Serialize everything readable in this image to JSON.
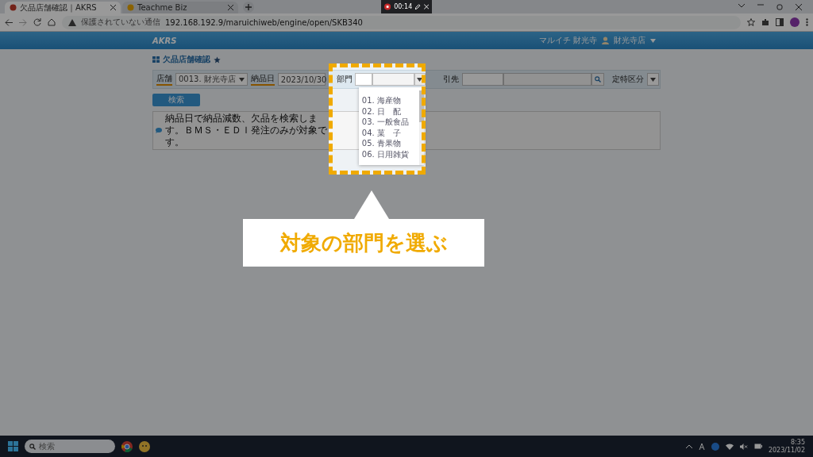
{
  "browser": {
    "tabs": [
      {
        "title": "欠品店舗確認｜AKRS",
        "selected": true
      },
      {
        "title": "Teachme Biz",
        "selected": false
      }
    ],
    "address": {
      "security": "保護されていない通信",
      "url": "192.168.192.9/maruichiweb/engine/open/SKB340"
    }
  },
  "recorder": {
    "time": "00:14"
  },
  "app_header": {
    "logo": "AKRS",
    "company": "マルイチ 財光寺",
    "user": "財光寺店"
  },
  "page": {
    "title": "欠品店舗確認",
    "form": {
      "store": {
        "label": "店舗",
        "value": "0013. 財光寺店"
      },
      "delivery_date": {
        "label": "納品日",
        "value": "2023/10/30"
      },
      "department": {
        "label": "部門",
        "options": [
          "01. 海産物",
          "02. 日　配",
          "03. 一般食品",
          "04. 菓　子",
          "05. 青果物",
          "06. 日用雑貨"
        ]
      },
      "supplier": {
        "label": "引先"
      },
      "category": {
        "label": "定特区分"
      }
    },
    "search_button": "検索",
    "info": "納品日で納品減数、欠品を検索します。ＢＭＳ・ＥＤＩ発注のみが対象です。"
  },
  "callout": "対象の部門を選ぶ",
  "taskbar": {
    "search_placeholder": "検索",
    "time": "8:35",
    "date": "2023/11/02"
  }
}
